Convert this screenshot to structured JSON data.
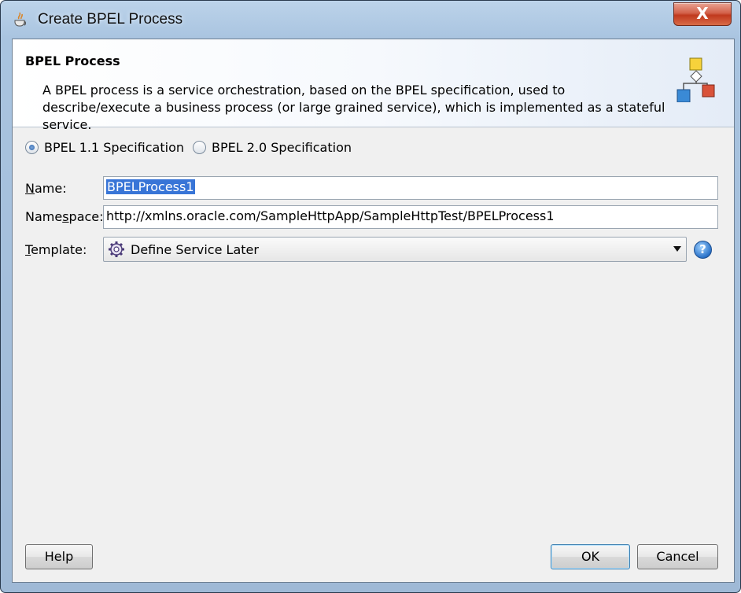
{
  "window": {
    "title": "Create BPEL Process",
    "close_label": "X"
  },
  "header": {
    "title": "BPEL Process",
    "description": "A BPEL process is a service orchestration, based on the BPEL specification, used to describe/execute a business process (or large grained service), which is implemented as a stateful service."
  },
  "spec": {
    "options": [
      {
        "label": "BPEL 1.1 Specification",
        "checked": true
      },
      {
        "label": "BPEL 2.0 Specification",
        "checked": false
      }
    ]
  },
  "fields": {
    "name": {
      "label_underlined": "N",
      "label_rest": "ame:",
      "value": "BPELProcess1"
    },
    "namespace": {
      "label_pre": "Name",
      "label_underlined": "s",
      "label_rest": "pace:",
      "value": "http://xmlns.oracle.com/SampleHttpApp/SampleHttpTest/BPELProcess1"
    },
    "template": {
      "label_underlined": "T",
      "label_rest": "emplate:",
      "value": "Define Service Later"
    }
  },
  "help_icon_label": "?",
  "buttons": {
    "help": "Help",
    "ok": "OK",
    "cancel": "Cancel"
  }
}
